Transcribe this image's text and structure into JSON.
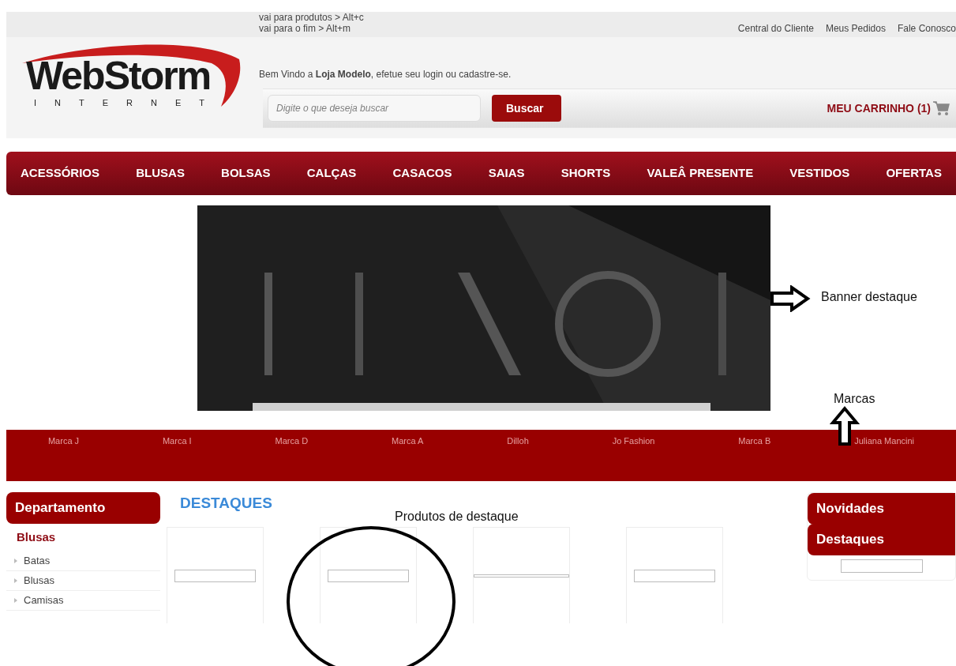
{
  "shortcuts": [
    "vai para produtos > Alt+c",
    "vai para o fim > Alt+m"
  ],
  "top_links": [
    "Central do Cliente",
    "Meus Pedidos",
    "Fale Conosco"
  ],
  "logo": {
    "name": "WebStorm",
    "tagline": "INTERNET"
  },
  "welcome": "Bem Vindo a **Loja Modelo**, efetue seu login ou cadastre-se.",
  "search": {
    "placeholder": "Digite o que deseja buscar",
    "button": "Buscar"
  },
  "cart": "MEU CARRINHO (1)",
  "nav": [
    "ACESSÓRIOS",
    "BLUSAS",
    "BOLSAS",
    "CALÇAS",
    "CASACOS",
    "SAIAS",
    "SHORTS",
    "VALEÂ PRESENTE",
    "VESTIDOS",
    "OFERTAS"
  ],
  "banner": {
    "kind": "picture"
  },
  "brands": [
    "Marca J",
    "Marca I",
    "Marca D",
    "Marca A",
    "Dilloh",
    "Jo Fashion",
    "Marca B",
    "Juliana Mancini"
  ],
  "sidebar": {
    "title": "Departamento",
    "category": "Blusas",
    "items": [
      "Batas",
      "Blusas",
      "Camisas"
    ]
  },
  "featured": {
    "title": "DESTAQUES",
    "products": [
      {
        "kind": "box"
      },
      {
        "kind": "box"
      },
      {
        "kind": "line"
      },
      {
        "kind": "box"
      }
    ]
  },
  "right_panel": {
    "tabs": [
      "Novidades",
      "Destaques"
    ]
  },
  "annotations": [
    {
      "kind": "arrow-right",
      "label": "Banner destaque"
    },
    {
      "kind": "arrow-up",
      "label": "Marcas"
    },
    {
      "kind": "circle",
      "label": "Produtos de destaque"
    }
  ]
}
